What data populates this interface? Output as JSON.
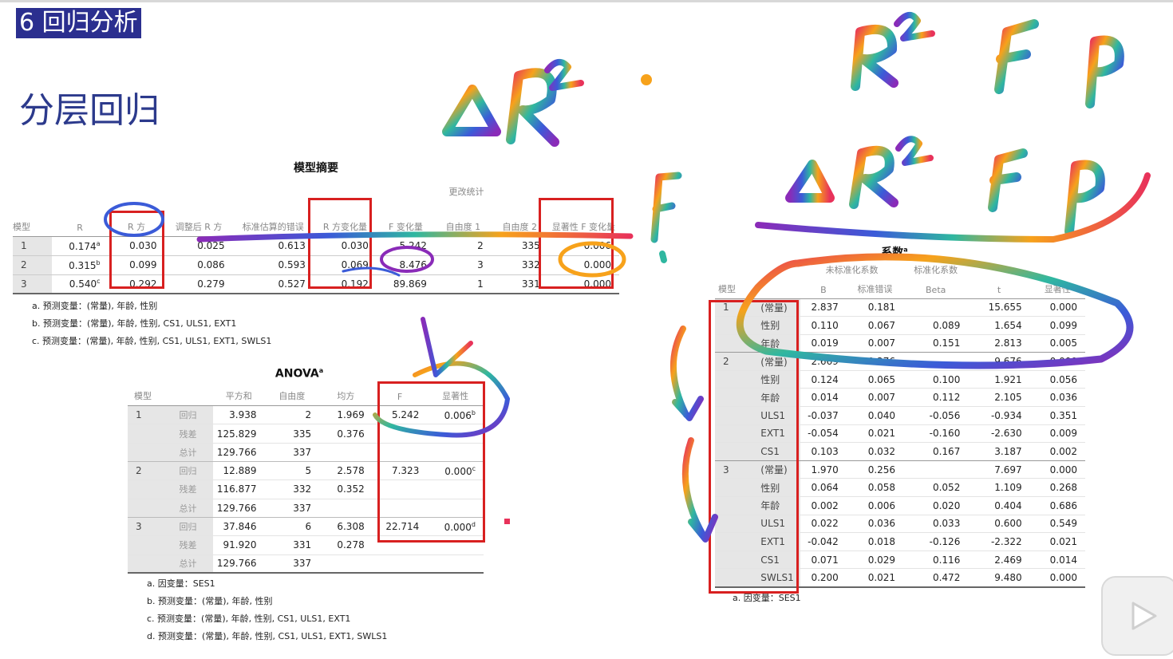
{
  "section_label": "6 回归分析",
  "slide_title": "分层回归",
  "model_summary": {
    "caption": "模型摘要",
    "change_stats_header": "更改统计",
    "columns": [
      "模型",
      "R",
      "R 方",
      "调整后 R 方",
      "标准估算的错误",
      "R 方变化量",
      "F 变化量",
      "自由度 1",
      "自由度 2",
      "显著性 F 变化量"
    ],
    "rows": [
      {
        "model": "1",
        "r": "0.174",
        "r_sup": "a",
        "r2": "0.030",
        "adj": "0.025",
        "se": "0.613",
        "r2c": "0.030",
        "fc": "5.242",
        "df1": "2",
        "df2": "335",
        "sig": "0.006"
      },
      {
        "model": "2",
        "r": "0.315",
        "r_sup": "b",
        "r2": "0.099",
        "adj": "0.086",
        "se": "0.593",
        "r2c": "0.069",
        "fc": "8.476",
        "df1": "3",
        "df2": "332",
        "sig": "0.000"
      },
      {
        "model": "3",
        "r": "0.540",
        "r_sup": "c",
        "r2": "0.292",
        "adj": "0.279",
        "se": "0.527",
        "r2c": "0.192",
        "fc": "89.869",
        "df1": "1",
        "df2": "331",
        "sig": "0.000"
      }
    ],
    "footnotes": [
      "a. 预测变量：(常量), 年龄, 性别",
      "b. 预测变量：(常量), 年龄, 性别, CS1, ULS1, EXT1",
      "c. 预测变量：(常量), 年龄, 性别, CS1, ULS1, EXT1, SWLS1"
    ]
  },
  "anova": {
    "caption": "ANOVA",
    "caption_sup": "a",
    "columns": [
      "模型",
      "",
      "平方和",
      "自由度",
      "均方",
      "F",
      "显著性"
    ],
    "rows": [
      {
        "model": "1",
        "src": "回归",
        "ss": "3.938",
        "df": "2",
        "ms": "1.969",
        "f": "5.242",
        "sig": "0.006",
        "sup": "b"
      },
      {
        "model": "",
        "src": "残差",
        "ss": "125.829",
        "df": "335",
        "ms": "0.376",
        "f": "",
        "sig": "",
        "sup": ""
      },
      {
        "model": "",
        "src": "总计",
        "ss": "129.766",
        "df": "337",
        "ms": "",
        "f": "",
        "sig": "",
        "sup": ""
      },
      {
        "model": "2",
        "src": "回归",
        "ss": "12.889",
        "df": "5",
        "ms": "2.578",
        "f": "7.323",
        "sig": "0.000",
        "sup": "c"
      },
      {
        "model": "",
        "src": "残差",
        "ss": "116.877",
        "df": "332",
        "ms": "0.352",
        "f": "",
        "sig": "",
        "sup": ""
      },
      {
        "model": "",
        "src": "总计",
        "ss": "129.766",
        "df": "337",
        "ms": "",
        "f": "",
        "sig": "",
        "sup": ""
      },
      {
        "model": "3",
        "src": "回归",
        "ss": "37.846",
        "df": "6",
        "ms": "6.308",
        "f": "22.714",
        "sig": "0.000",
        "sup": "d"
      },
      {
        "model": "",
        "src": "残差",
        "ss": "91.920",
        "df": "331",
        "ms": "0.278",
        "f": "",
        "sig": "",
        "sup": ""
      },
      {
        "model": "",
        "src": "总计",
        "ss": "129.766",
        "df": "337",
        "ms": "",
        "f": "",
        "sig": "",
        "sup": ""
      }
    ],
    "footnotes": [
      "a. 因变量：SES1",
      "b. 预测变量：(常量), 年龄, 性别",
      "c. 预测变量：(常量), 年龄, 性别, CS1, ULS1, EXT1",
      "d. 预测变量：(常量), 年龄, 性别, CS1, ULS1, EXT1, SWLS1"
    ]
  },
  "coefficients": {
    "caption": "系数",
    "caption_sup": "a",
    "group_unstd": "未标准化系数",
    "group_std": "标准化系数",
    "columns": [
      "模型",
      "",
      "B",
      "标准错误",
      "Beta",
      "t",
      "显著性"
    ],
    "rows": [
      {
        "model": "1",
        "var": "(常量)",
        "b": "2.837",
        "se": "0.181",
        "beta": "",
        "t": "15.655",
        "sig": "0.000"
      },
      {
        "model": "",
        "var": "性别",
        "b": "0.110",
        "se": "0.067",
        "beta": "0.089",
        "t": "1.654",
        "sig": "0.099"
      },
      {
        "model": "",
        "var": "年龄",
        "b": "0.019",
        "se": "0.007",
        "beta": "0.151",
        "t": "2.813",
        "sig": "0.005"
      },
      {
        "model": "2",
        "var": "(常量)",
        "b": "2.669",
        "se": "0.276",
        "beta": "",
        "t": "9.676",
        "sig": "0.000"
      },
      {
        "model": "",
        "var": "性别",
        "b": "0.124",
        "se": "0.065",
        "beta": "0.100",
        "t": "1.921",
        "sig": "0.056"
      },
      {
        "model": "",
        "var": "年龄",
        "b": "0.014",
        "se": "0.007",
        "beta": "0.112",
        "t": "2.105",
        "sig": "0.036"
      },
      {
        "model": "",
        "var": "ULS1",
        "b": "-0.037",
        "se": "0.040",
        "beta": "-0.056",
        "t": "-0.934",
        "sig": "0.351"
      },
      {
        "model": "",
        "var": "EXT1",
        "b": "-0.054",
        "se": "0.021",
        "beta": "-0.160",
        "t": "-2.630",
        "sig": "0.009"
      },
      {
        "model": "",
        "var": "CS1",
        "b": "0.103",
        "se": "0.032",
        "beta": "0.167",
        "t": "3.187",
        "sig": "0.002"
      },
      {
        "model": "3",
        "var": "(常量)",
        "b": "1.970",
        "se": "0.256",
        "beta": "",
        "t": "7.697",
        "sig": "0.000"
      },
      {
        "model": "",
        "var": "性别",
        "b": "0.064",
        "se": "0.058",
        "beta": "0.052",
        "t": "1.109",
        "sig": "0.268"
      },
      {
        "model": "",
        "var": "年龄",
        "b": "0.002",
        "se": "0.006",
        "beta": "0.020",
        "t": "0.404",
        "sig": "0.686"
      },
      {
        "model": "",
        "var": "ULS1",
        "b": "0.022",
        "se": "0.036",
        "beta": "0.033",
        "t": "0.600",
        "sig": "0.549"
      },
      {
        "model": "",
        "var": "EXT1",
        "b": "-0.042",
        "se": "0.018",
        "beta": "-0.126",
        "t": "-2.322",
        "sig": "0.021"
      },
      {
        "model": "",
        "var": "CS1",
        "b": "0.071",
        "se": "0.029",
        "beta": "0.116",
        "t": "2.469",
        "sig": "0.014"
      },
      {
        "model": "",
        "var": "SWLS1",
        "b": "0.200",
        "se": "0.021",
        "beta": "0.472",
        "t": "9.480",
        "sig": "0.000"
      }
    ],
    "footnotes": [
      "a. 因变量：SES1"
    ]
  },
  "annotations": {
    "stroke_colors": [
      "#e8325a",
      "#f7a21b",
      "#2fb7a0",
      "#3b5bd8",
      "#8a2bb8",
      "#c9d72a"
    ],
    "box_color": "#d82020",
    "handwriting": [
      "ΔR²",
      "R²",
      "F",
      "P",
      "ΔR²",
      "F",
      "P",
      "F"
    ]
  },
  "video_overlay": {
    "icon": "play-icon"
  }
}
